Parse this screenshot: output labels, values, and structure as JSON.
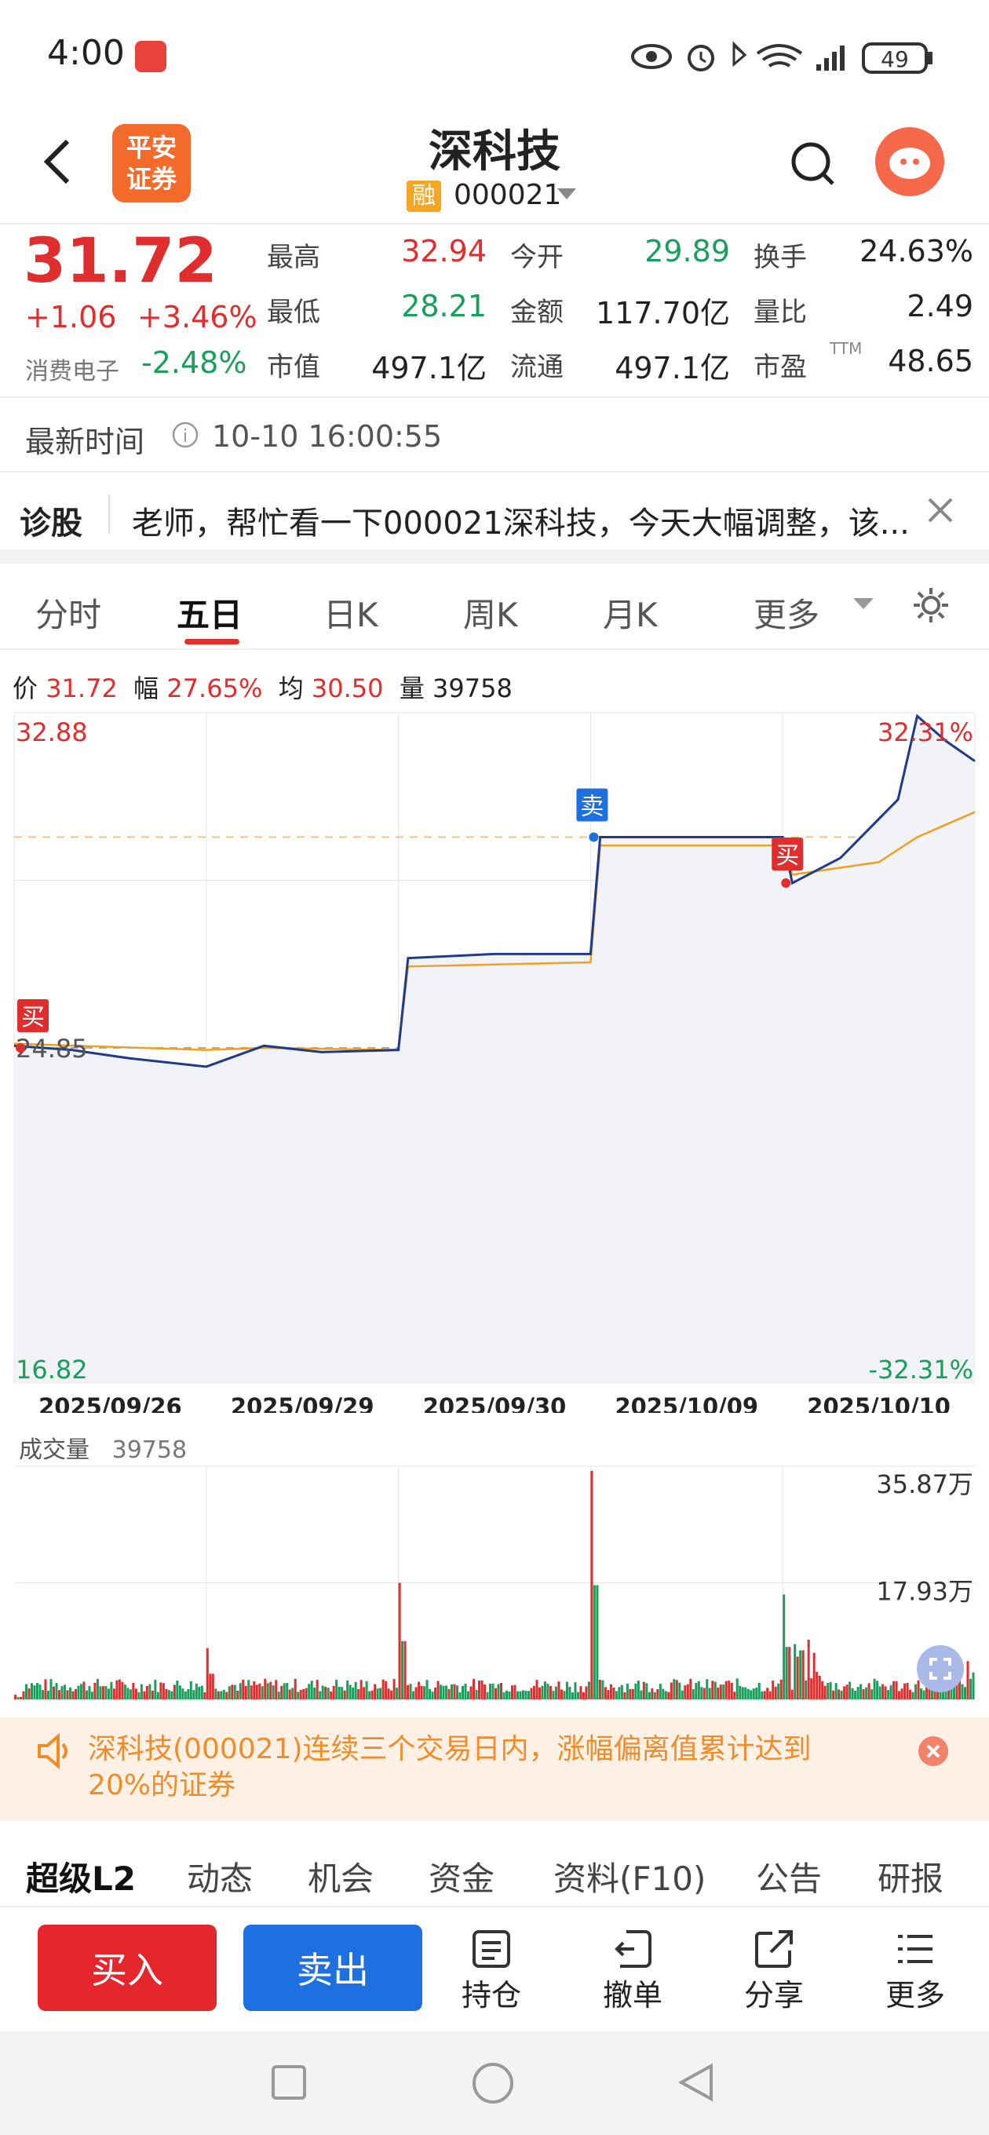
{
  "status_bar": {
    "time": "4:00",
    "battery": "49"
  },
  "header": {
    "title": "深科技",
    "tag": "融",
    "code": "000021",
    "logo_line1": "平安",
    "logo_line2": "证券"
  },
  "quote": {
    "price": "31.72",
    "change": "+1.06",
    "change_pct": "+3.46%",
    "sector_name": "消费电子",
    "sector_pct": "-2.48%",
    "fields": [
      {
        "k": "最高",
        "v": "32.94",
        "c": "red"
      },
      {
        "k": "今开",
        "v": "29.89",
        "c": "green"
      },
      {
        "k": "换手",
        "v": "24.63%",
        "c": "dark"
      },
      {
        "k": "最低",
        "v": "28.21",
        "c": "green"
      },
      {
        "k": "金额",
        "v": "117.70亿",
        "c": "dark"
      },
      {
        "k": "量比",
        "v": "2.49",
        "c": "dark"
      },
      {
        "k": "市值",
        "v": "497.1亿",
        "c": "dark"
      },
      {
        "k": "流通",
        "v": "497.1亿",
        "c": "dark"
      },
      {
        "k": "市盈",
        "v": "48.65",
        "c": "dark",
        "sup": "TTM"
      }
    ]
  },
  "latest": {
    "label": "最新时间",
    "value": "10-10 16:00:55"
  },
  "diagnosis": {
    "label": "诊股",
    "text": "老师，帮忙看一下000021深科技，今天大幅调整，该..."
  },
  "tabs": [
    "分时",
    "五日",
    "日K",
    "周K",
    "月K",
    "更多"
  ],
  "info_line": {
    "price_label": "价",
    "price": "31.72",
    "amp_label": "幅",
    "amp": "27.65%",
    "avg_label": "均",
    "avg": "30.50",
    "vol_label": "量",
    "vol": "39758"
  },
  "chart_data": {
    "type": "line",
    "title": "",
    "x": [
      "2025/09/26",
      "2025/09/29",
      "2025/09/30",
      "2025/10/09",
      "2025/10/10"
    ],
    "ylim": [
      16.82,
      32.88
    ],
    "ylabels_left": {
      "top": "32.88",
      "bottom": "16.82",
      "mid": "24.85"
    },
    "ylabels_right": {
      "top": "32.31%",
      "bottom": "-32.31%"
    },
    "prev_close": 24.85,
    "series": [
      {
        "values": [
          [
            0,
            24.9
          ],
          [
            0.3,
            24.8
          ],
          [
            0.6,
            24.6
          ],
          [
            1,
            24.4
          ],
          [
            1.3,
            24.9
          ],
          [
            1.6,
            24.75
          ],
          [
            2,
            24.8
          ],
          [
            2.05,
            27.0
          ],
          [
            2.5,
            27.1
          ],
          [
            3,
            27.1
          ],
          [
            3.05,
            29.9
          ],
          [
            3.5,
            29.9
          ],
          [
            4,
            29.9
          ],
          [
            4.05,
            28.8
          ],
          [
            4.3,
            29.4
          ],
          [
            4.6,
            30.8
          ],
          [
            4.7,
            32.8
          ],
          [
            4.85,
            32.2
          ],
          [
            5,
            31.72
          ]
        ]
      },
      {
        "values": [
          [
            0,
            24.95
          ],
          [
            1,
            24.8
          ],
          [
            1.3,
            24.85
          ],
          [
            2,
            24.8
          ],
          [
            2.05,
            26.8
          ],
          [
            3,
            26.9
          ],
          [
            3.05,
            29.7
          ],
          [
            4,
            29.7
          ],
          [
            4.05,
            29.0
          ],
          [
            4.5,
            29.3
          ],
          [
            4.7,
            29.9
          ],
          [
            5,
            30.5
          ]
        ]
      }
    ],
    "markers": [
      {
        "day": 0,
        "label": "买"
      },
      {
        "day": 3,
        "label": "卖"
      },
      {
        "day": 4,
        "label": "买"
      }
    ]
  },
  "volume": {
    "label": "成交量",
    "value": "39758",
    "max": "35.87万",
    "mid": "17.93万"
  },
  "notice": {
    "text": "深科技(000021)连续三个交易日内，涨幅偏离值累计达到20%的证券"
  },
  "bottom_tabs": [
    "超级L2",
    "动态",
    "机会",
    "资金",
    "资料(F10)",
    "公告",
    "研报"
  ],
  "actions": {
    "buy": "买入",
    "sell": "卖出",
    "tools": [
      "持仓",
      "撤单",
      "分享",
      "更多"
    ]
  },
  "colors": {
    "red": "#e02d2d",
    "green": "#1a9e5c",
    "blue": "#1e6fe0",
    "price_line": "#1f3a8a",
    "avg_line": "#f0a020"
  }
}
